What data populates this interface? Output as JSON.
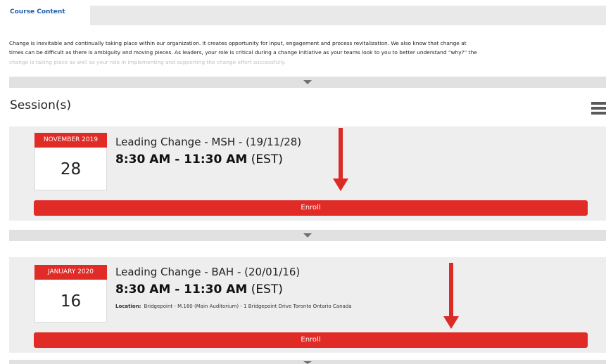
{
  "tabs": {
    "active_label": "Course Content"
  },
  "description": {
    "line1": "Change is inevitable and continually taking place within our organization. It creates opportunity for input, engagement and process revitalization. We also know that change at",
    "line2": "times can be difficult as there is ambiguity and moving pieces. As leaders, your role is critical during a change initiative as your teams look to you to better understand “why?” the",
    "line3": "change is taking place as well as your role in implementing and supporting the change effort successfully."
  },
  "sessions": {
    "title": "Session(s)",
    "items": [
      {
        "month": "NOVEMBER 2019",
        "day": "28",
        "title": "Leading Change - MSH - (19/11/28)",
        "time": "8:30 AM - 11:30 AM",
        "timezone": "(EST)",
        "enroll_label": "Enroll"
      },
      {
        "month": "JANUARY 2020",
        "day": "16",
        "title": "Leading Change - BAH - (20/01/16)",
        "time": "8:30 AM - 11:30 AM",
        "timezone": "(EST)",
        "location_label": "Location:",
        "location": "Bridgepoint - M.160 (Main Auditorium) - 1 Bridgepoint Drive Toronto Ontario Canada",
        "enroll_label": "Enroll"
      }
    ]
  },
  "colors": {
    "accent": "#e02b26",
    "tab_text": "#1f5fa8",
    "panel": "#eeeeee",
    "expander": "#e1e1e1"
  },
  "icons": [
    "expand-triangle-icon",
    "list-view-icon",
    "arrow-down-annotation-icon"
  ]
}
